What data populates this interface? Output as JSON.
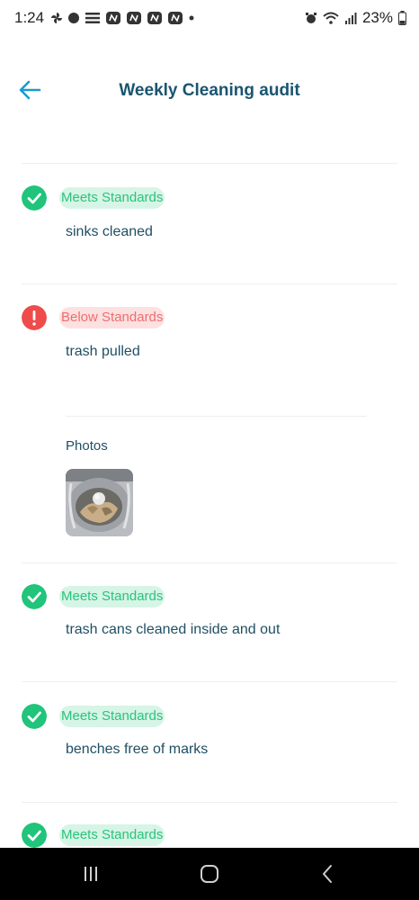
{
  "status_bar": {
    "time": "1:24",
    "battery": "23%",
    "left_icons": [
      "pinwheel-icon",
      "chat-icon",
      "e-logo-icon",
      "notification-app-icon",
      "notification-app-icon",
      "notification-app-icon",
      "notification-app-icon",
      "dot-icon"
    ],
    "right_icons": [
      "alarm-icon",
      "wifi-icon",
      "signal-icon",
      "battery-icon"
    ]
  },
  "header": {
    "title": "Weekly Cleaning audit",
    "back_icon": "arrow-left-icon"
  },
  "items": [
    {
      "status": "Meets Standards",
      "label": "sinks cleaned"
    },
    {
      "status": "Below Standards",
      "label": "trash pulled"
    },
    {
      "status": "Meets Standards",
      "label": "trash cans cleaned inside and out"
    },
    {
      "status": "Meets Standards",
      "label": "benches free of marks"
    },
    {
      "status": "Meets Standards",
      "label": ""
    }
  ],
  "photos": {
    "label": "Photos"
  },
  "nav_bar": {
    "buttons": [
      "recents-icon",
      "home-icon",
      "back-icon"
    ]
  },
  "colors": {
    "accent": "#1a9bd1",
    "good": "#20c47a",
    "good_bg": "#d6f5e6",
    "bad": "#ef4b4b",
    "bad_bg": "#fde1e1",
    "text": "#1f4f64"
  }
}
